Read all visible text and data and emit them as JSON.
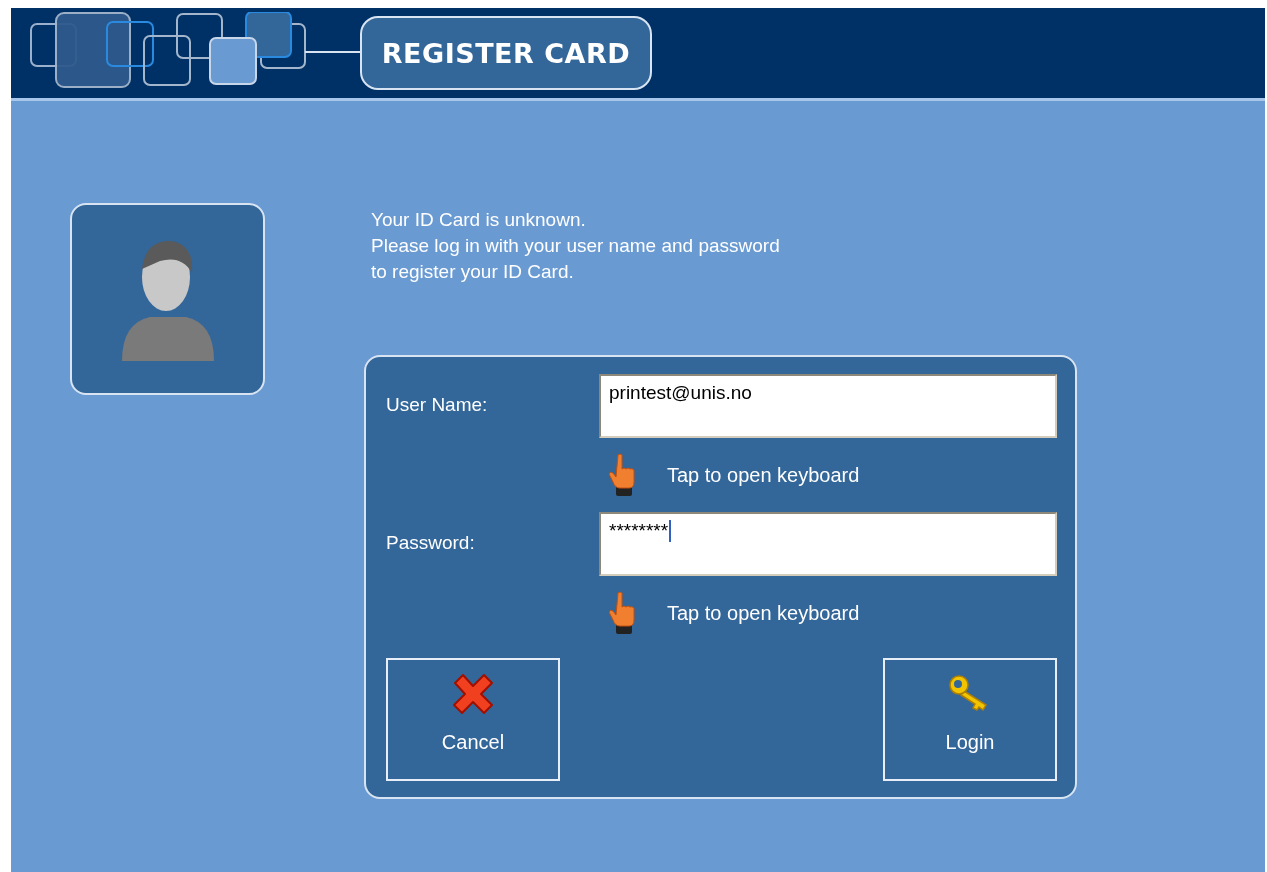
{
  "header": {
    "title": "REGISTER CARD"
  },
  "message": [
    "Your ID Card is unknown.",
    "Please log in with your user name and password",
    "to register your ID Card."
  ],
  "form": {
    "fields": [
      {
        "label": "User Name:",
        "value": "printest@unis.no",
        "focused": false,
        "hint": "Tap to open keyboard"
      },
      {
        "label": "Password:",
        "value": "********",
        "focused": true,
        "hint": "Tap to open keyboard"
      }
    ],
    "buttons": [
      {
        "label": "Cancel",
        "kind": "cancel"
      },
      {
        "label": "Login",
        "kind": "login"
      }
    ]
  }
}
